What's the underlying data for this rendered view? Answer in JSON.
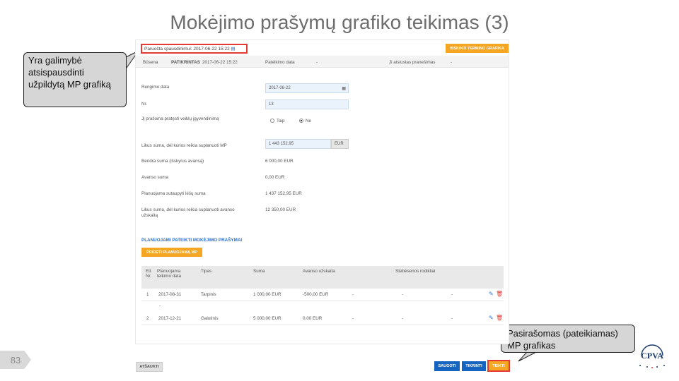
{
  "slide": {
    "title": "Mokėjimo prašymų grafiko teikimas (3)",
    "page_number": "83"
  },
  "callouts": {
    "left": "Yra galimybė atsispausdinti užpildytą MP grafiką",
    "right": "Pasirašomas (pateikiamas) MP grafikas"
  },
  "screen": {
    "prepared_label": "Paruošta spausdinimui: 2017-06-22 15:22",
    "print_button": "ISSIUNTI TERMINO GRAFIKA",
    "status": {
      "state_label": "Būsena",
      "state_value": "PATIKRINTAS",
      "state_time": "2017-06-22 15:22",
      "submit_date_label": "Pateikimo data",
      "submit_date_value": "-",
      "notice_label": "Ji atsiustas pranešimas",
      "notice_value": "-"
    },
    "form": {
      "date_label": "Rengimo data",
      "date_value": "2017-06-22",
      "nr_label": "Nr.",
      "nr_value": "13",
      "extend_label": "Jį prašoma pratęsti veiklų įgyvendinimą",
      "radio_yes": "Taip",
      "radio_no": "Ne",
      "remaining_label": "Likus suma, dėl kurios reikia suplanuoti MP",
      "remaining_value": "1 443 152,95",
      "remaining_currency": "EUR",
      "total_label": "Bendra suma (išskyrus avansą)",
      "total_value": "6 000,00 EUR",
      "advance_label": "Avanso suma",
      "advance_value": "0,00 EUR",
      "planned_label": "Planuojama sutaupyti lėšų suma",
      "planned_value": "1 437 152,95 EUR",
      "remaining_adv_label": "Likus suma, dėl kurios reikia suplanuoti avanso",
      "remaining_adv_label2": "užskaitą",
      "remaining_adv_value": "12 350,00 EUR"
    },
    "section_title": "PLANUOJAMI PATEIKTI MOKĖJIMO PRAŠYMAI",
    "add_button": "PRIDĖTI PLANUOJAMĄ MP",
    "table": {
      "headers": [
        "Eil. Nr.",
        "Planuojama teikimo data",
        "Tipas",
        "Suma",
        "Avanso užskaita",
        "Stebėsenos rodikliai"
      ],
      "rows": [
        {
          "nr": "1",
          "date": "2017-08-31",
          "type": "Tarpinis",
          "sum": "1 000,00 EUR",
          "advance": "-500,00 EUR",
          "c1": "-",
          "c2": "-",
          "c3": "-",
          "sub": "-"
        },
        {
          "nr": "2",
          "date": "2017-12-21",
          "type": "Galutinis",
          "sum": "5 000,00 EUR",
          "advance": "0,00 EUR",
          "c1": "-",
          "c2": "-",
          "c3": "-"
        }
      ]
    },
    "bottom": {
      "back": "ATŠAUKTI",
      "save": "SAUGOTI",
      "check": "TIKRINTI",
      "submit": "TEIKTI"
    }
  },
  "logo_text": "CPVA",
  "colors": {
    "accent_orange": "#f5a623",
    "button_blue": "#1565c0",
    "highlight_red": "#e53935"
  }
}
